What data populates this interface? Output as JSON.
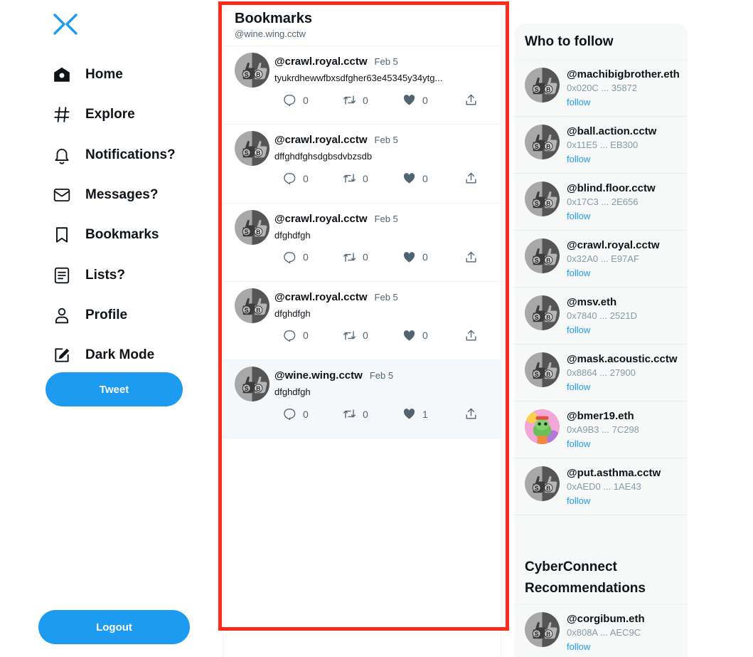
{
  "nav": {
    "items": [
      {
        "label": "Home",
        "icon": "home-icon"
      },
      {
        "label": "Explore",
        "icon": "hashtag-icon"
      },
      {
        "label": "Notifications?",
        "icon": "bell-icon"
      },
      {
        "label": "Messages?",
        "icon": "mail-icon"
      },
      {
        "label": "Bookmarks",
        "icon": "bookmark-icon"
      },
      {
        "label": "Lists?",
        "icon": "list-icon"
      },
      {
        "label": "Profile",
        "icon": "person-icon"
      },
      {
        "label": "Dark Mode",
        "icon": "dark-mode-icon"
      }
    ],
    "tweet_label": "Tweet",
    "logout_label": "Logout"
  },
  "main": {
    "title": "Bookmarks",
    "subtitle": "@wine.wing.cctw",
    "posts": [
      {
        "handle": "@crawl.royal.cctw",
        "date": "Feb 5",
        "text": "tyukrdhewwfbxsdfgher63e45345y34ytg...",
        "replies": "0",
        "retweets": "0",
        "likes": "0"
      },
      {
        "handle": "@crawl.royal.cctw",
        "date": "Feb 5",
        "text": "dffghdfghsdgbsdvbzsdb",
        "replies": "0",
        "retweets": "0",
        "likes": "0"
      },
      {
        "handle": "@crawl.royal.cctw",
        "date": "Feb 5",
        "text": "dfghdfgh",
        "replies": "0",
        "retweets": "0",
        "likes": "0"
      },
      {
        "handle": "@crawl.royal.cctw",
        "date": "Feb 5",
        "text": "dfghdfgh",
        "replies": "0",
        "retweets": "0",
        "likes": "0"
      },
      {
        "handle": "@wine.wing.cctw",
        "date": "Feb 5",
        "text": "dfghdfgh",
        "replies": "0",
        "retweets": "0",
        "likes": "1"
      }
    ]
  },
  "sidebar": {
    "who_title": "Who to follow",
    "who": [
      {
        "handle": "@machibigbrother.eth",
        "address": "0x020C ... 35872",
        "follow": "follow"
      },
      {
        "handle": "@ball.action.cctw",
        "address": "0x11E5 ... EB300",
        "follow": "follow"
      },
      {
        "handle": "@blind.floor.cctw",
        "address": "0x17C3 ... 2E656",
        "follow": "follow"
      },
      {
        "handle": "@crawl.royal.cctw",
        "address": "0x32A0 ... E97AF",
        "follow": "follow"
      },
      {
        "handle": "@msv.eth",
        "address": "0x7840 ... 2521D",
        "follow": "follow"
      },
      {
        "handle": "@mask.acoustic.cctw",
        "address": "0x8864 ... 27900",
        "follow": "follow"
      },
      {
        "handle": "@bmer19.eth",
        "address": "0xA9B3 ... 7C298",
        "follow": "follow"
      },
      {
        "handle": "@put.asthma.cctw",
        "address": "0xAED0 ... 1AE43",
        "follow": "follow"
      }
    ],
    "cc_title": "CyberConnect Recommendations",
    "cc": [
      {
        "handle": "@corgibum.eth",
        "address": "0x808A ... AEC9C",
        "follow": "follow"
      }
    ]
  },
  "colors": {
    "accent": "#1d9bf0",
    "highlight_frame": "#ff2a1a"
  }
}
